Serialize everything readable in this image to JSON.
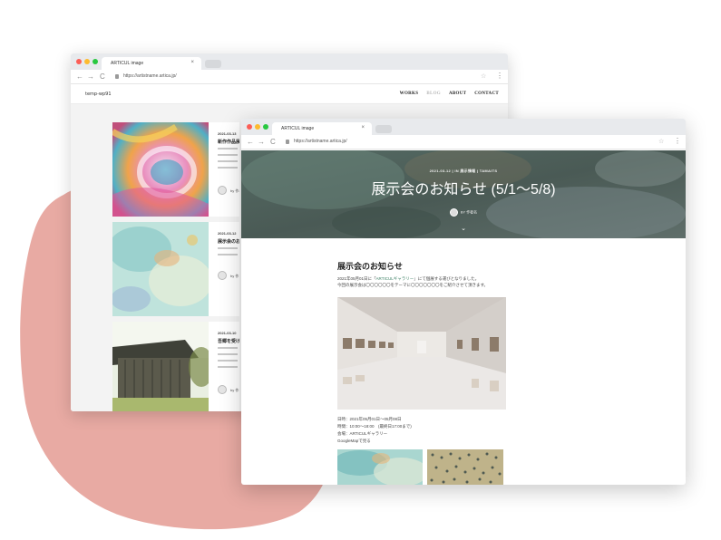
{
  "colors": {
    "blob": "#e8aaa3",
    "accent_link": "#3a7f63",
    "hero_overlay": "#4a5a55"
  },
  "back_window": {
    "tab_title": "ARTICUL image",
    "tab_close": "×",
    "url": "https://artistname.artica.jp/",
    "nav": {
      "back": "←",
      "forward": "→",
      "reload": "C",
      "star": "☆",
      "menu": "⋮"
    },
    "site": {
      "logo": "temp-wp91",
      "menu": [
        "WORKS",
        "BLOG",
        "ABOUT",
        "CONTACT"
      ]
    },
    "posts": [
      {
        "date": "2021-03-13",
        "title": "新作作品展",
        "by": "by 作者名"
      },
      {
        "date": "2021-03-12",
        "title": "展示会のお",
        "by": "by 作"
      },
      {
        "date": "2021-03-10",
        "title": "吾郷を受け",
        "by": "by 作"
      }
    ]
  },
  "front_window": {
    "tab_title": "ARTICUL image",
    "tab_close": "×",
    "url": "https://artistname.artica.jp/",
    "nav": {
      "back": "←",
      "forward": "→",
      "reload": "C",
      "star": "☆",
      "menu": "⋮"
    },
    "hero": {
      "meta": "2021-03-12   |   IN 展示情報   |   TAMAITS",
      "title": "展示会のお知らせ (5/1〜5/8)",
      "author": "BY 作者名",
      "chevron": "⌄"
    },
    "article": {
      "heading": "展示会のお知らせ",
      "p1_pre": "2021年05月01日に「",
      "p1_link": "ARTICULギャラリー",
      "p1_post": "」にて個展する運びとなりました。",
      "p2": "今回の展示会は〇〇〇〇〇〇をテーマに〇〇〇〇〇〇〇をご紹介させて頂きます。",
      "date_line": "日時：2021年05月01日〜05月08日",
      "time_line": "時間：10:00〜18:00　(最終日17:00まで)",
      "venue_line": "会場：ARTICULギャラリー",
      "map_line": "GoogleMapで見る"
    }
  }
}
